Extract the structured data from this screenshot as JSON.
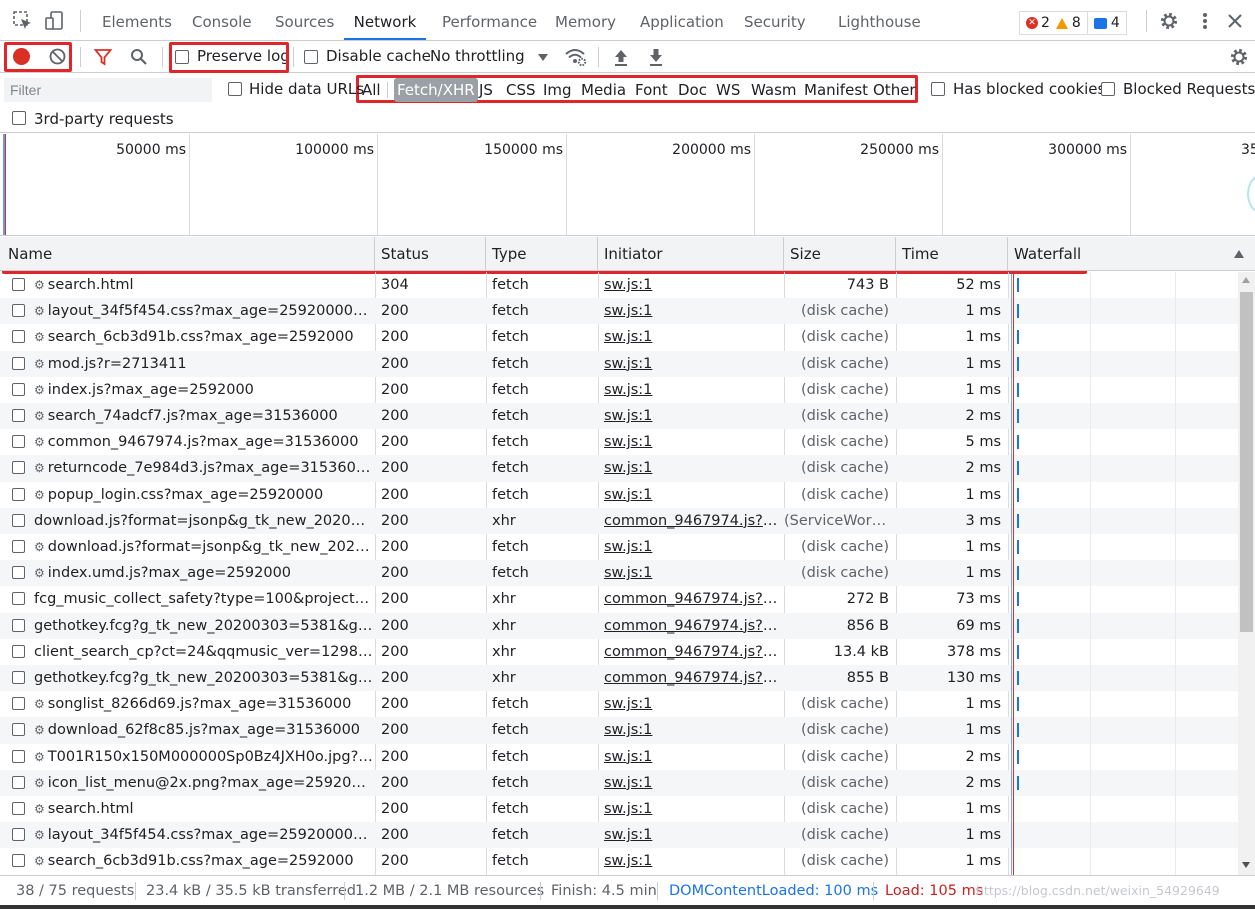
{
  "tabs": [
    "Elements",
    "Console",
    "Sources",
    "Network",
    "Performance",
    "Memory",
    "Application",
    "Security",
    "Lighthouse"
  ],
  "active_tab": "Network",
  "counters": {
    "errors": "2",
    "warnings": "8",
    "messages": "4"
  },
  "toolbar": {
    "preserve_log": "Preserve log",
    "disable_cache": "Disable cache",
    "throttling": "No throttling"
  },
  "filter": {
    "placeholder": "Filter",
    "hide_data_urls": "Hide data URLs",
    "types": [
      "All",
      "Fetch/XHR",
      "JS",
      "CSS",
      "Img",
      "Media",
      "Font",
      "Doc",
      "WS",
      "Wasm",
      "Manifest",
      "Other"
    ],
    "selected_type": "Fetch/XHR",
    "has_blocked_cookies": "Has blocked cookies",
    "blocked_requests": "Blocked Requests",
    "third_party": "3rd-party requests"
  },
  "overview_ticks": [
    "50000 ms",
    "100000 ms",
    "150000 ms",
    "200000 ms",
    "250000 ms",
    "300000 ms",
    "35"
  ],
  "columns": [
    "Name",
    "Status",
    "Type",
    "Initiator",
    "Size",
    "Time",
    "Waterfall"
  ],
  "rows": [
    {
      "name": "search.html",
      "gear": true,
      "status": "304",
      "type": "fetch",
      "initiator": "sw.js:1",
      "size": "743 B",
      "time": "52 ms"
    },
    {
      "name": "layout_34f5f454.css?max_age=25920000&v=2...",
      "gear": true,
      "status": "200",
      "type": "fetch",
      "initiator": "sw.js:1",
      "size": "(disk cache)",
      "time": "1 ms"
    },
    {
      "name": "search_6cb3d91b.css?max_age=2592000",
      "gear": true,
      "status": "200",
      "type": "fetch",
      "initiator": "sw.js:1",
      "size": "(disk cache)",
      "time": "1 ms"
    },
    {
      "name": "mod.js?r=2713411",
      "gear": true,
      "status": "200",
      "type": "fetch",
      "initiator": "sw.js:1",
      "size": "(disk cache)",
      "time": "1 ms"
    },
    {
      "name": "index.js?max_age=2592000",
      "gear": true,
      "status": "200",
      "type": "fetch",
      "initiator": "sw.js:1",
      "size": "(disk cache)",
      "time": "1 ms"
    },
    {
      "name": "search_74adcf7.js?max_age=31536000",
      "gear": true,
      "status": "200",
      "type": "fetch",
      "initiator": "sw.js:1",
      "size": "(disk cache)",
      "time": "2 ms"
    },
    {
      "name": "common_9467974.js?max_age=31536000",
      "gear": true,
      "status": "200",
      "type": "fetch",
      "initiator": "sw.js:1",
      "size": "(disk cache)",
      "time": "5 ms"
    },
    {
      "name": "returncode_7e984d3.js?max_age=31536000",
      "gear": true,
      "status": "200",
      "type": "fetch",
      "initiator": "sw.js:1",
      "size": "(disk cache)",
      "time": "2 ms"
    },
    {
      "name": "popup_login.css?max_age=25920000",
      "gear": true,
      "status": "200",
      "type": "fetch",
      "initiator": "sw.js:1",
      "size": "(disk cache)",
      "time": "1 ms"
    },
    {
      "name": "download.js?format=jsonp&g_tk_new_20200303...",
      "gear": false,
      "status": "200",
      "type": "xhr",
      "initiator": "common_9467974.js?ma...",
      "size": "(ServiceWork...",
      "time": "3 ms"
    },
    {
      "name": "download.js?format=jsonp&g_tk_new_202003...",
      "gear": true,
      "status": "200",
      "type": "fetch",
      "initiator": "sw.js:1",
      "size": "(disk cache)",
      "time": "1 ms"
    },
    {
      "name": "index.umd.js?max_age=2592000",
      "gear": true,
      "status": "200",
      "type": "fetch",
      "initiator": "sw.js:1",
      "size": "(disk cache)",
      "time": "1 ms"
    },
    {
      "name": "fcg_music_collect_safety?type=100&projectnam...",
      "gear": false,
      "status": "200",
      "type": "xhr",
      "initiator": "common_9467974.js?ma...",
      "size": "272 B",
      "time": "73 ms"
    },
    {
      "name": "gethotkey.fcg?g_tk_new_20200303=5381&g_tk=...",
      "gear": false,
      "status": "200",
      "type": "xhr",
      "initiator": "common_9467974.js?ma...",
      "size": "856 B",
      "time": "69 ms"
    },
    {
      "name": "client_search_cp?ct=24&qqmusic_ver=1298&ne...",
      "gear": false,
      "status": "200",
      "type": "xhr",
      "initiator": "common_9467974.js?ma...",
      "size": "13.4 kB",
      "time": "378 ms"
    },
    {
      "name": "gethotkey.fcg?g_tk_new_20200303=5381&g_tk=...",
      "gear": false,
      "status": "200",
      "type": "xhr",
      "initiator": "common_9467974.js?ma...",
      "size": "855 B",
      "time": "130 ms"
    },
    {
      "name": "songlist_8266d69.js?max_age=31536000",
      "gear": true,
      "status": "200",
      "type": "fetch",
      "initiator": "sw.js:1",
      "size": "(disk cache)",
      "time": "1 ms"
    },
    {
      "name": "download_62f8c85.js?max_age=31536000",
      "gear": true,
      "status": "200",
      "type": "fetch",
      "initiator": "sw.js:1",
      "size": "(disk cache)",
      "time": "1 ms"
    },
    {
      "name": "T001R150x150M000000Sp0Bz4JXH0o.jpg?max...",
      "gear": true,
      "status": "200",
      "type": "fetch",
      "initiator": "sw.js:1",
      "size": "(disk cache)",
      "time": "2 ms"
    },
    {
      "name": "icon_list_menu@2x.png?max_age=2592000&v...",
      "gear": true,
      "status": "200",
      "type": "fetch",
      "initiator": "sw.js:1",
      "size": "(disk cache)",
      "time": "2 ms"
    },
    {
      "name": "search.html",
      "gear": true,
      "status": "200",
      "type": "fetch",
      "initiator": "sw.js:1",
      "size": "(disk cache)",
      "time": "1 ms"
    },
    {
      "name": "layout_34f5f454.css?max_age=25920000&v=2...",
      "gear": true,
      "status": "200",
      "type": "fetch",
      "initiator": "sw.js:1",
      "size": "(disk cache)",
      "time": "1 ms"
    },
    {
      "name": "search_6cb3d91b.css?max_age=2592000",
      "gear": true,
      "status": "200",
      "type": "fetch",
      "initiator": "sw.js:1",
      "size": "(disk cache)",
      "time": "1 ms"
    }
  ],
  "status_bar": {
    "requests": "38 / 75 requests",
    "transferred": "23.4 kB / 35.5 kB transferred",
    "resources": "1.2 MB / 2.1 MB resources",
    "finish": "Finish: 4.5 min",
    "dom_content_loaded": "DOMContentLoaded: 100 ms",
    "load": "Load: 105 ms",
    "watermark": "https://blog.csdn.net/weixin_54929649"
  },
  "colors": {
    "accent": "#1a73e8",
    "highlight_box": "#e0262a",
    "record": "#d93025"
  }
}
